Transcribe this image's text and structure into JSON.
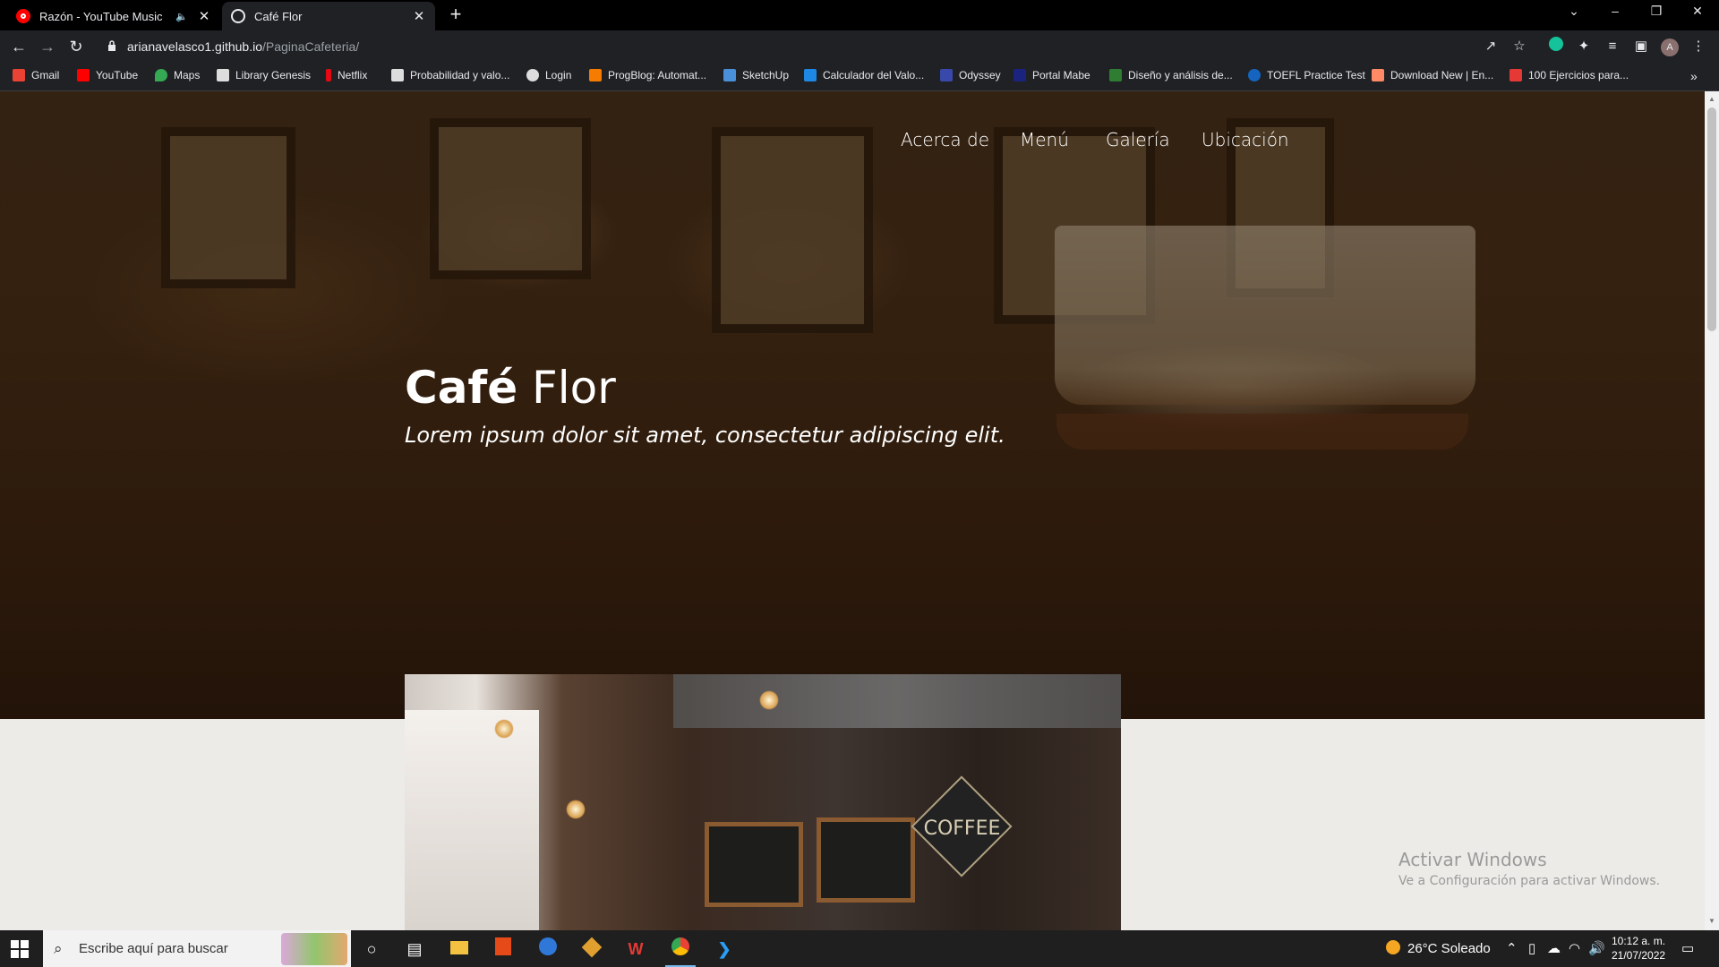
{
  "browser": {
    "tabs": [
      {
        "title": "Razón - YouTube Music",
        "active": false,
        "audio": true
      },
      {
        "title": "Café Flor",
        "active": true,
        "audio": false
      }
    ],
    "url_host": "arianavelasco1.github.io",
    "url_path": "/PaginaCafeteria/",
    "bookmarks": [
      {
        "label": "Gmail",
        "color": "#ea4335"
      },
      {
        "label": "YouTube",
        "color": "#ff0000"
      },
      {
        "label": "Maps",
        "color": "#34a853"
      },
      {
        "label": "Library Genesis",
        "color": "#dddddd"
      },
      {
        "label": "Netflix",
        "color": "#e50914"
      },
      {
        "label": "Probabilidad y valo...",
        "color": "#dddddd"
      },
      {
        "label": "Login",
        "color": "#dddddd"
      },
      {
        "label": "ProgBlog: Automat...",
        "color": "#f57c00"
      },
      {
        "label": "SketchUp",
        "color": "#4a90d9"
      },
      {
        "label": "Calculador del Valo...",
        "color": "#1e88e5"
      },
      {
        "label": "Odyssey",
        "color": "#3949ab"
      },
      {
        "label": "Portal Mabe",
        "color": "#1a237e"
      },
      {
        "label": "Diseño y análisis de...",
        "color": "#2e7d32"
      },
      {
        "label": "TOEFL Practice Test",
        "color": "#1565c0"
      },
      {
        "label": "Download New | En...",
        "color": "#ff8a65"
      },
      {
        "label": "100 Ejercicios para...",
        "color": "#e53935"
      }
    ]
  },
  "site": {
    "nav": [
      "Acerca de",
      "Menú",
      "Galería",
      "Ubicación"
    ],
    "title_bold": "Café",
    "title_light": "Flor",
    "subtitle": "Lorem ipsum dolor sit amet, consectetur adipiscing elit.",
    "photo_sign": "COFFEE"
  },
  "windows_activation": {
    "line1": "Activar Windows",
    "line2": "Ve a Configuración para activar Windows."
  },
  "taskbar": {
    "search_placeholder": "Escribe aquí para buscar",
    "weather": "26°C  Soleado",
    "time": "10:12 a. m.",
    "date": "21/07/2022"
  }
}
